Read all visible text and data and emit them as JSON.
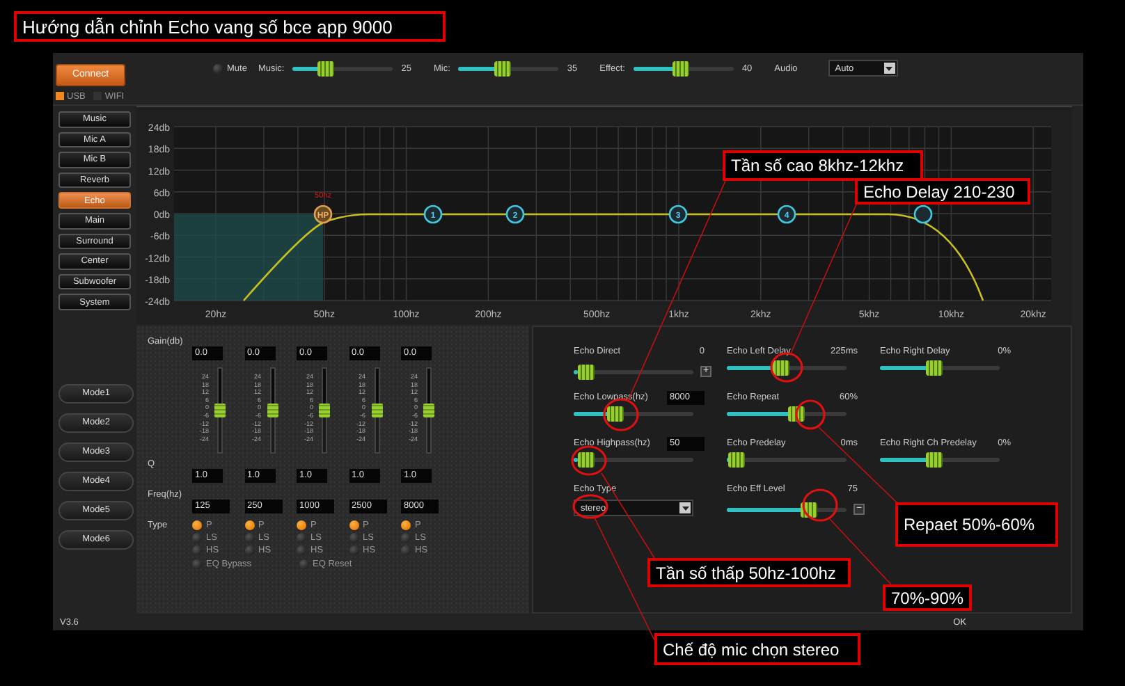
{
  "top_bar": {
    "connect": "Connect",
    "interfaces": [
      {
        "label": "USB",
        "selected": true
      },
      {
        "label": "WIFI",
        "selected": false
      }
    ],
    "mute": {
      "label": "Mute",
      "checked": false
    },
    "levels": [
      {
        "label": "Music:",
        "level": 0.3,
        "reading": "25"
      },
      {
        "label": "Mic:",
        "level": 0.42,
        "reading": "35"
      },
      {
        "label": "Effect:",
        "level": 0.47,
        "reading": "40"
      }
    ],
    "audio": {
      "label": "Audio",
      "value": "Auto"
    }
  },
  "sidebar": {
    "items": [
      {
        "label": "Music",
        "selected": false
      },
      {
        "label": "Mic A",
        "selected": false
      },
      {
        "label": "Mic B",
        "selected": false
      },
      {
        "label": "Reverb",
        "selected": false
      },
      {
        "label": "Echo",
        "selected": true
      },
      {
        "label": "Main",
        "selected": false
      },
      {
        "label": "Surround",
        "selected": false
      },
      {
        "label": "Center",
        "selected": false
      },
      {
        "label": "Subwoofer",
        "selected": false
      },
      {
        "label": "System",
        "selected": false
      }
    ],
    "modes": [
      "Mode1",
      "Mode2",
      "Mode3",
      "Mode4",
      "Mode5",
      "Mode6"
    ]
  },
  "chart": {
    "y_labels": [
      "24db",
      "18db",
      "12db",
      "6db",
      "0db",
      "-6db",
      "-12db",
      "-18db",
      "-24db"
    ],
    "x_labels": [
      "20hz",
      "50hz",
      "100hz",
      "200hz",
      "500hz",
      "1khz",
      "2khz",
      "5khz",
      "10khz",
      "20khz"
    ],
    "marker": "50hz",
    "nodes": [
      {
        "label": "HP",
        "kind": "pass"
      },
      {
        "label": "1",
        "kind": "band"
      },
      {
        "label": "2",
        "kind": "band"
      },
      {
        "label": "3",
        "kind": "band"
      },
      {
        "label": "4",
        "kind": "band"
      },
      {
        "kind": "band"
      }
    ]
  },
  "eq": {
    "labels": {
      "gain": "Gain(db)",
      "q": "Q",
      "freq": "Freq(hz)",
      "type": "Type"
    },
    "bands": [
      {
        "gain": "0.0",
        "level": 0.5,
        "scale": [
          "24",
          "18",
          "12",
          "6",
          "0",
          "-6",
          "-12",
          "-18",
          "-24"
        ],
        "q": "1.0",
        "freq": "125",
        "types": [
          {
            "label": "P",
            "selected": true
          },
          {
            "label": "LS",
            "selected": false
          },
          {
            "label": "HS",
            "selected": false
          }
        ]
      },
      {
        "gain": "0.0",
        "level": 0.5,
        "scale": [
          "24",
          "18",
          "12",
          "6",
          "0",
          "-6",
          "-12",
          "-18",
          "-24"
        ],
        "q": "1.0",
        "freq": "250",
        "types": [
          {
            "label": "P",
            "selected": true
          },
          {
            "label": "LS",
            "selected": false
          },
          {
            "label": "HS",
            "selected": false
          }
        ]
      },
      {
        "gain": "0.0",
        "level": 0.5,
        "scale": [
          "24",
          "18",
          "12",
          "6",
          "0",
          "-6",
          "-12",
          "-18",
          "-24"
        ],
        "q": "1.0",
        "freq": "1000",
        "types": [
          {
            "label": "P",
            "selected": true
          },
          {
            "label": "LS",
            "selected": false
          },
          {
            "label": "HS",
            "selected": false
          }
        ]
      },
      {
        "gain": "0.0",
        "level": 0.5,
        "scale": [
          "24",
          "18",
          "12",
          "6",
          "0",
          "-6",
          "-12",
          "-18",
          "-24"
        ],
        "q": "1.0",
        "freq": "2500",
        "types": [
          {
            "label": "P",
            "selected": true
          },
          {
            "label": "LS",
            "selected": false
          },
          {
            "label": "HS",
            "selected": false
          }
        ]
      },
      {
        "gain": "0.0",
        "level": 0.5,
        "scale": [
          "24",
          "18",
          "12",
          "6",
          "0",
          "-6",
          "-12",
          "-18",
          "-24"
        ],
        "q": "1.0",
        "freq": "8000",
        "types": [
          {
            "label": "P",
            "selected": true
          },
          {
            "label": "LS",
            "selected": false
          },
          {
            "label": "HS",
            "selected": false
          }
        ]
      }
    ],
    "options": [
      {
        "label": "EQ Bypass",
        "checked": false
      },
      {
        "label": "EQ Reset",
        "checked": false
      }
    ]
  },
  "echo": {
    "rows": [
      [
        {
          "kind": "slider",
          "label": "Echo Direct",
          "reading": "0",
          "level": 0.04,
          "button": "+"
        },
        {
          "kind": "slider",
          "label": "Echo Left Delay",
          "reading": "225ms",
          "level": 0.45
        },
        {
          "kind": "slider",
          "label": "Echo Right Delay",
          "reading": "0%",
          "level": 0.45
        }
      ],
      [
        {
          "kind": "field",
          "label": "Echo Lowpass(hz)",
          "value": "8000",
          "level": 0.33
        },
        {
          "kind": "slider",
          "label": "Echo Repeat",
          "reading": "60%",
          "level": 0.6
        }
      ],
      [
        {
          "kind": "field",
          "label": "Echo Highpass(hz)",
          "value": "50",
          "level": 0.04
        },
        {
          "kind": "slider",
          "label": "Echo Predelay",
          "reading": "0ms",
          "level": 0.02
        },
        {
          "kind": "slider",
          "label": "Echo Right Ch Predelay",
          "reading": "0%",
          "level": 0.45
        }
      ],
      [
        {
          "kind": "dropdown",
          "label": "Echo Type",
          "value": "stereo"
        },
        {
          "kind": "slider",
          "label": "Echo Eff Level",
          "reading": "75",
          "level": 0.72,
          "button": "−"
        }
      ]
    ]
  },
  "status_bar": {
    "version": "V3.6",
    "ok": "OK"
  },
  "annotations": [
    {
      "text": "Hướng dẫn chỉnh Echo vang số bce app 9000"
    },
    {
      "text": "Tần số cao 8khz-12khz"
    },
    {
      "text": "Echo Delay 210-230"
    },
    {
      "text": "Repaet 50%-60%"
    },
    {
      "text": "Tần số thấp 50hz-100hz"
    },
    {
      "text": "70%-90%"
    },
    {
      "text": "Chế độ mic chọn stereo"
    }
  ]
}
